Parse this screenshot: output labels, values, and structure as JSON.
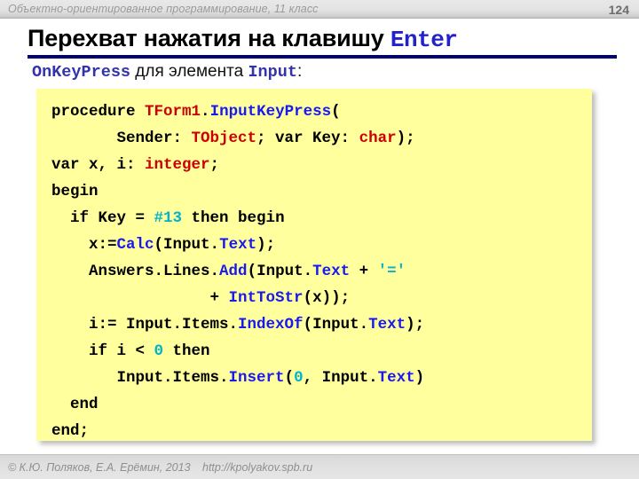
{
  "header": {
    "course_title": "Объектно-ориентированное программирование, 11 класс",
    "page_number": "124"
  },
  "slide": {
    "title_text": "Перехват нажатия на клавишу ",
    "title_keyword": "Enter",
    "subtitle_keyword_1": "OnKeyPress",
    "subtitle_middle": " для элемента ",
    "subtitle_keyword_2": "Input",
    "subtitle_tail": ":"
  },
  "code": {
    "language": "pascal",
    "lines": [
      {
        "indent": 0,
        "tokens": [
          {
            "t": "procedure ",
            "c": "plain"
          },
          {
            "t": "TForm1",
            "c": "type"
          },
          {
            "t": ".",
            "c": "plain"
          },
          {
            "t": "InputKeyPress",
            "c": "fn"
          },
          {
            "t": "(",
            "c": "plain"
          }
        ]
      },
      {
        "indent": 7,
        "tokens": [
          {
            "t": "Sender: ",
            "c": "plain"
          },
          {
            "t": "TObject",
            "c": "type"
          },
          {
            "t": "; var Key: ",
            "c": "plain"
          },
          {
            "t": "char",
            "c": "type"
          },
          {
            "t": ");",
            "c": "plain"
          }
        ]
      },
      {
        "indent": 0,
        "tokens": [
          {
            "t": "var x, i: ",
            "c": "plain"
          },
          {
            "t": "integer",
            "c": "type"
          },
          {
            "t": ";",
            "c": "plain"
          }
        ]
      },
      {
        "indent": 0,
        "tokens": [
          {
            "t": "begin",
            "c": "plain"
          }
        ]
      },
      {
        "indent": 2,
        "tokens": [
          {
            "t": "if Key = ",
            "c": "plain"
          },
          {
            "t": "#13",
            "c": "num"
          },
          {
            "t": " then begin",
            "c": "plain"
          }
        ]
      },
      {
        "indent": 4,
        "tokens": [
          {
            "t": "x:=",
            "c": "plain"
          },
          {
            "t": "Calc",
            "c": "fn"
          },
          {
            "t": "(Input.",
            "c": "plain"
          },
          {
            "t": "Text",
            "c": "fn"
          },
          {
            "t": ");",
            "c": "plain"
          }
        ]
      },
      {
        "indent": 4,
        "tokens": [
          {
            "t": "Answers.Lines.",
            "c": "plain"
          },
          {
            "t": "Add",
            "c": "fn"
          },
          {
            "t": "(Input.",
            "c": "plain"
          },
          {
            "t": "Text",
            "c": "fn"
          },
          {
            "t": " + ",
            "c": "plain"
          },
          {
            "t": "'='",
            "c": "str"
          }
        ]
      },
      {
        "indent": 17,
        "tokens": [
          {
            "t": "+ ",
            "c": "plain"
          },
          {
            "t": "IntToStr",
            "c": "fn"
          },
          {
            "t": "(x));",
            "c": "plain"
          }
        ]
      },
      {
        "indent": 4,
        "tokens": [
          {
            "t": "i:= Input.Items.",
            "c": "plain"
          },
          {
            "t": "IndexOf",
            "c": "fn"
          },
          {
            "t": "(Input.",
            "c": "plain"
          },
          {
            "t": "Text",
            "c": "fn"
          },
          {
            "t": ");",
            "c": "plain"
          }
        ]
      },
      {
        "indent": 4,
        "tokens": [
          {
            "t": "if i < ",
            "c": "plain"
          },
          {
            "t": "0",
            "c": "num"
          },
          {
            "t": " then",
            "c": "plain"
          }
        ]
      },
      {
        "indent": 7,
        "tokens": [
          {
            "t": "Input.Items.",
            "c": "plain"
          },
          {
            "t": "Insert",
            "c": "fn"
          },
          {
            "t": "(",
            "c": "plain"
          },
          {
            "t": "0",
            "c": "num"
          },
          {
            "t": ", Input.",
            "c": "plain"
          },
          {
            "t": "Text",
            "c": "fn"
          },
          {
            "t": ")",
            "c": "plain"
          }
        ]
      },
      {
        "indent": 2,
        "tokens": [
          {
            "t": "end",
            "c": "plain"
          }
        ]
      },
      {
        "indent": 0,
        "tokens": [
          {
            "t": "end;",
            "c": "plain"
          }
        ]
      }
    ]
  },
  "footer": {
    "copyright": "© К.Ю. Поляков, Е.А. Ерёмин, 2013",
    "url": "http://kpolyakov.spb.ru"
  },
  "colors": {
    "accent_rule": "#000066",
    "code_background": "#ffff9e",
    "keyword_blue": "#1a1aee",
    "type_red": "#cc0000",
    "literal_cyan": "#00b4cc"
  }
}
